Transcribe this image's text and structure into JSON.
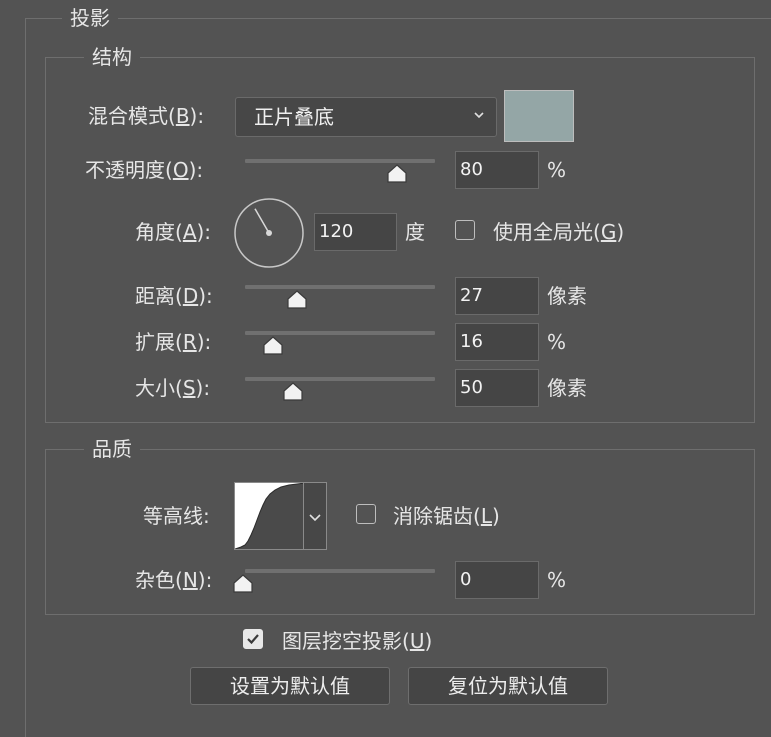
{
  "panel": {
    "title": "投影"
  },
  "structure": {
    "legend": "结构",
    "blend_mode": {
      "label_prefix": "混合模式(",
      "label_key": "B",
      "label_suffix": "):",
      "value": "正片叠底",
      "shadow_color": "#94a6a6"
    },
    "opacity": {
      "label_prefix": "不透明度(",
      "label_key": "O",
      "label_suffix": "):",
      "value": "80",
      "unit": "%",
      "level": 0.8
    },
    "angle": {
      "label_prefix": "角度(",
      "label_key": "A",
      "label_suffix": "):",
      "value": "120",
      "unit": "度",
      "degrees": 120,
      "global_light": {
        "label_prefix": "使用全局光(",
        "label_key": "G",
        "label_suffix": ")",
        "checked": false
      }
    },
    "distance": {
      "label_prefix": "距离(",
      "label_key": "D",
      "label_suffix": "):",
      "value": "27",
      "unit": "像素"
    },
    "spread": {
      "label_prefix": "扩展(",
      "label_key": "R",
      "label_suffix": "):",
      "value": "16",
      "unit": "%"
    },
    "size": {
      "label_prefix": "大小(",
      "label_key": "S",
      "label_suffix": "):",
      "value": "50",
      "unit": "像素"
    }
  },
  "quality": {
    "legend": "品质",
    "contour": {
      "label": "等高线:",
      "anti_alias": {
        "label_prefix": "消除锯齿(",
        "label_key": "L",
        "label_suffix": ")",
        "checked": false
      }
    },
    "noise": {
      "label_prefix": "杂色(",
      "label_key": "N",
      "label_suffix": "):",
      "value": "0",
      "unit": "%"
    }
  },
  "knockout": {
    "label_prefix": "图层挖空投影(",
    "label_key": "U",
    "label_suffix": ")",
    "checked": true
  },
  "buttons": {
    "make_default": "设置为默认值",
    "reset_default": "复位为默认值"
  }
}
